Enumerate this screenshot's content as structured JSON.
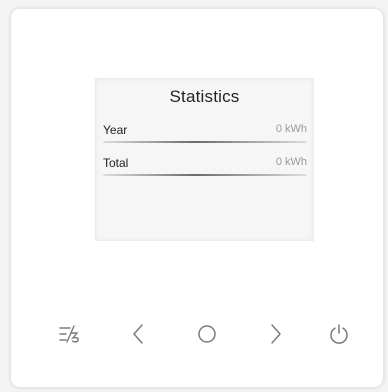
{
  "screen": {
    "title": "Statistics",
    "rows": [
      {
        "label": "Year",
        "value": "0 kWh"
      },
      {
        "label": "Total",
        "value": "0 kWh"
      }
    ]
  },
  "buttons": [
    {
      "name": "mode-button",
      "icon": "mode-icon"
    },
    {
      "name": "left-button",
      "icon": "chevron-left-icon"
    },
    {
      "name": "ok-button",
      "icon": "circle-icon"
    },
    {
      "name": "right-button",
      "icon": "chevron-right-icon"
    },
    {
      "name": "power-button",
      "icon": "power-icon"
    }
  ],
  "colors": {
    "panel": "#ffffff",
    "screen": "#f6f6f6",
    "text": "#222222",
    "muted": "#9a9a9a",
    "icon": "#7a7a7a"
  }
}
